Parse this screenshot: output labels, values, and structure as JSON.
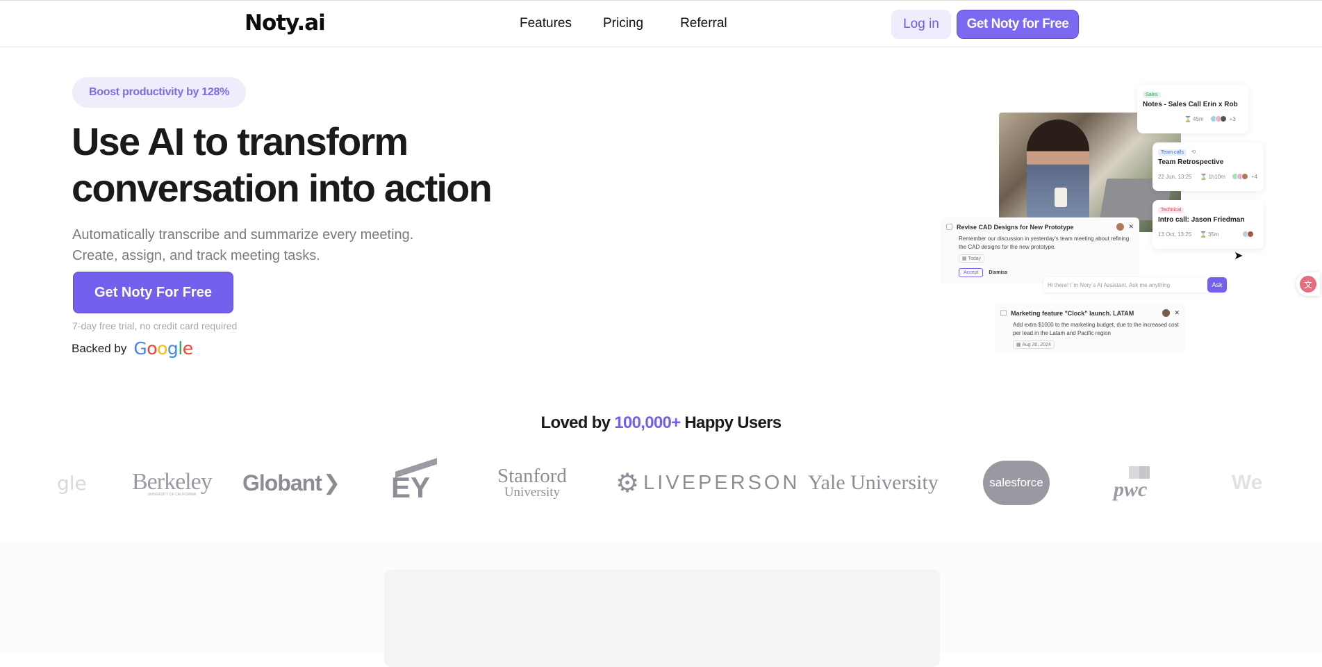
{
  "nav": {
    "logo": "Noty.ai",
    "links": [
      "Features",
      "Pricing",
      "Referral"
    ],
    "login": "Log in",
    "get_free": "Get Noty for Free"
  },
  "hero": {
    "badge": "Boost productivity by 128%",
    "title_line1": "Use AI to transform",
    "title_line2": "conversation into action",
    "sub_line1": "Automatically transcribe and summarize every meeting.",
    "sub_line2": "Create, assign, and track meeting tasks.",
    "cta": "Get Noty For Free",
    "trial": "7-day free trial, no credit card required",
    "backed_by": "Backed by",
    "google": "Google"
  },
  "collage": {
    "card1": {
      "tag": "Sales",
      "title": "Notes - Sales Call Erin x Rob",
      "duration": "45m",
      "extra": "+3"
    },
    "card2": {
      "tag": "Team calls",
      "title": "Team Retrospective",
      "date": "22 Jun, 13:25",
      "duration": "1h10m",
      "extra": "+4"
    },
    "card3": {
      "tag": "Technical",
      "title": "Intro call: Jason Friedman",
      "date": "13 Oct, 13:25",
      "duration": "35m"
    },
    "task1": {
      "title": "Revise CAD Designs for New Prototype",
      "body": "Remember our discussion in yesterday's team meeting about refining the CAD designs for the new prototype.",
      "date": "Today",
      "accept": "Accept",
      "dismiss": "Dismiss"
    },
    "ask": {
      "placeholder": "Hi there! I`m Noty`s AI Assistant. Ask me anything",
      "button": "Ask"
    },
    "task2": {
      "title": "Marketing feature \"Clock\" launch. LATAM",
      "body": "Add extra $1000 to the marketing budget, due to the increased cost per lead in the Latam and Pacific region",
      "date": "Aug 30, 2024"
    }
  },
  "social": {
    "loved_prefix": "Loved by",
    "loved_count": "100,000+",
    "loved_suffix": "Happy Users",
    "logos": [
      "gle",
      "Berkeley",
      "UNIVERSITY OF CALIFORNIA",
      "Globant",
      "EY",
      "Stanford",
      "University",
      "LIVEPERSON",
      "Yale University",
      "salesforce",
      "pwc",
      "We"
    ]
  },
  "colors": {
    "accent": "#7361ee",
    "accent_light": "#efedfd",
    "logo_gray": "#8e8f96"
  }
}
